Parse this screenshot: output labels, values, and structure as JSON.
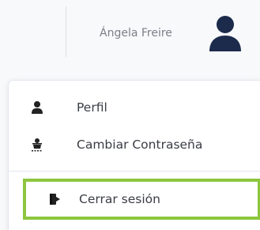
{
  "header": {
    "user_name": "Ángela Freire",
    "avatar_icon": "user-avatar-icon"
  },
  "user_menu": {
    "items": [
      {
        "label": "Perfil",
        "icon": "user-icon"
      },
      {
        "label": "Cambiar Contraseña",
        "icon": "user-secret-icon"
      },
      {
        "label": "Cerrar sesión",
        "icon": "sign-out-icon"
      }
    ],
    "highlight_color": "#8cc63f"
  }
}
